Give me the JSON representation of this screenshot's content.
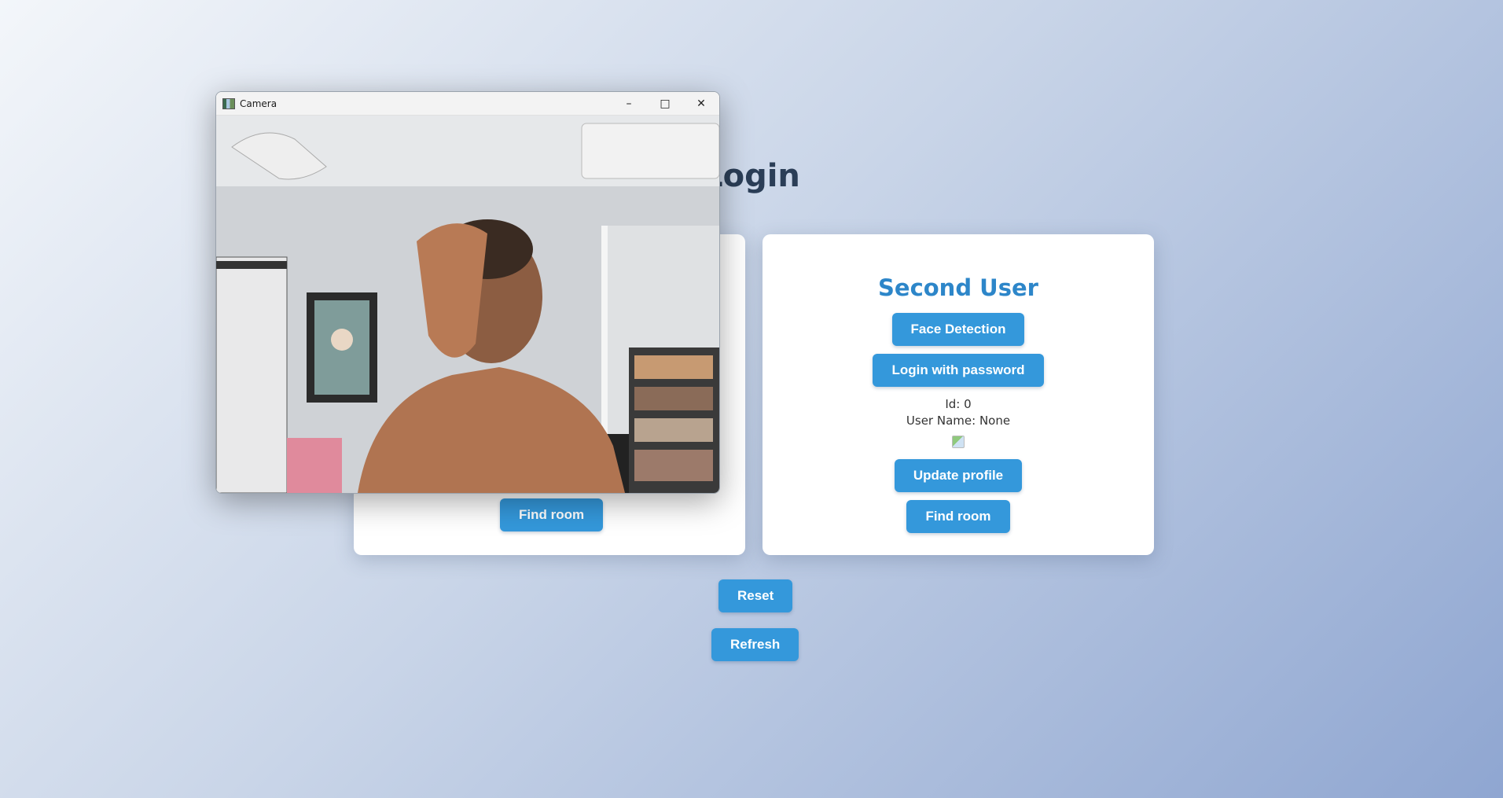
{
  "page": {
    "title": "Login"
  },
  "left_card": {
    "find_room_label": "Find room"
  },
  "right_card": {
    "title": "Second User",
    "face_detection_label": "Face Detection",
    "login_password_label": "Login with password",
    "id_text": "Id: 0",
    "user_name_text": "User Name: None",
    "update_profile_label": "Update profile",
    "find_room_label": "Find room"
  },
  "actions": {
    "reset_label": "Reset",
    "refresh_label": "Refresh"
  },
  "camera_window": {
    "title": "Camera",
    "app_icon": "camera-app-icon",
    "minimize_glyph": "–",
    "maximize_glyph": "□",
    "close_glyph": "✕"
  },
  "colors": {
    "accent": "#3498db",
    "title_text": "#2b3e57",
    "card_title": "#2d86c9"
  }
}
